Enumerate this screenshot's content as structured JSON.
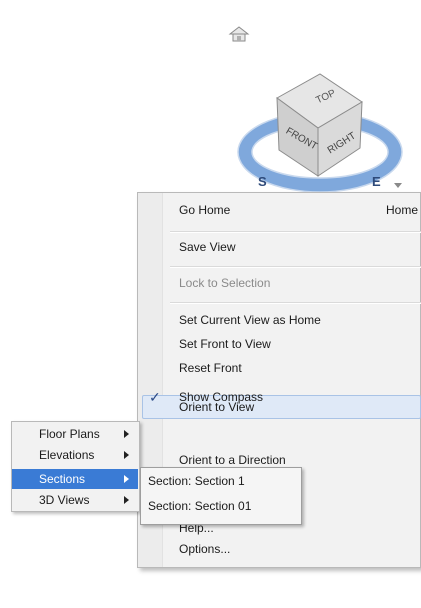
{
  "viewcube": {
    "top_face": "TOP",
    "front_face": "FRONT",
    "right_face": "RIGHT",
    "compass_letters": [
      "S",
      "E"
    ]
  },
  "context_menu": {
    "items": [
      {
        "label": "Go Home",
        "shortcut": "Home"
      },
      {
        "label": "Save View"
      },
      {
        "label": "Lock to Selection",
        "disabled": true
      },
      {
        "label": "Set Current View as Home"
      },
      {
        "label": "Set Front to View"
      },
      {
        "label": "Reset Front"
      },
      {
        "label": "Show Compass",
        "checked": true
      },
      {
        "label": "Orient to View",
        "highlighted": true
      },
      {
        "label": "Orient to a Direction"
      },
      {
        "label": "Help..."
      },
      {
        "label": "Options..."
      }
    ],
    "check_glyph": "✓"
  },
  "views_submenu": {
    "items": [
      {
        "label": "Floor Plans"
      },
      {
        "label": "Elevations"
      },
      {
        "label": "Sections",
        "selected": true
      },
      {
        "label": "3D Views"
      }
    ]
  },
  "sections_submenu": {
    "items": [
      {
        "label": "Section: Section 1"
      },
      {
        "label": "Section: Section 01"
      }
    ]
  },
  "colors": {
    "highlight_selected": "#3a7bd5",
    "highlight_hover": "#dfe9f7",
    "compass_ring": "#7fa8dc",
    "cube_face": "#d9d9d9"
  }
}
